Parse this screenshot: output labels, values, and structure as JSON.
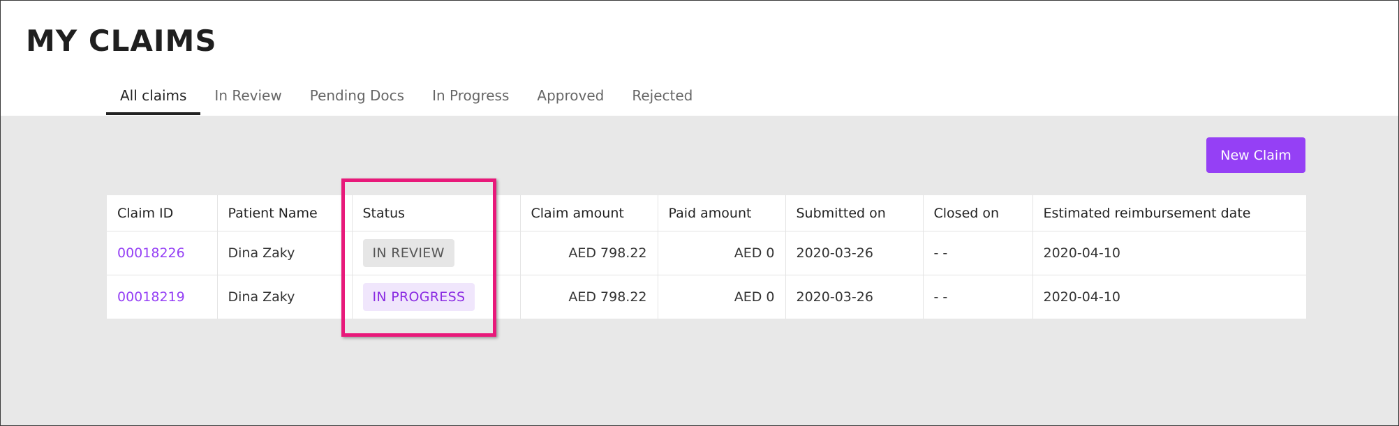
{
  "page": {
    "title": "MY CLAIMS"
  },
  "tabs": [
    {
      "label": "All claims",
      "active": true
    },
    {
      "label": "In Review",
      "active": false
    },
    {
      "label": "Pending Docs",
      "active": false
    },
    {
      "label": "In Progress",
      "active": false
    },
    {
      "label": "Approved",
      "active": false
    },
    {
      "label": "Rejected",
      "active": false
    }
  ],
  "actions": {
    "new_claim_label": "New Claim"
  },
  "table": {
    "columns": [
      "Claim ID",
      "Patient Name",
      "Status",
      "Claim amount",
      "Paid amount",
      "Submitted on",
      "Closed on",
      "Estimated reimbursement date"
    ],
    "rows": [
      {
        "claim_id": "00018226",
        "patient_name": "Dina Zaky",
        "status": "IN REVIEW",
        "claim_amount": "AED 798.22",
        "paid_amount": "AED 0",
        "submitted_on": "2020-03-26",
        "closed_on": "- -",
        "estimated_reimbursement": "2020-04-10"
      },
      {
        "claim_id": "00018219",
        "patient_name": "Dina Zaky",
        "status": "IN PROGRESS",
        "claim_amount": "AED 798.22",
        "paid_amount": "AED 0",
        "submitted_on": "2020-03-26",
        "closed_on": "- -",
        "estimated_reimbursement": "2020-04-10"
      }
    ]
  },
  "colors": {
    "accent": "#9540f5",
    "highlight": "#e8197a",
    "background_area": "#e8e8e8"
  }
}
